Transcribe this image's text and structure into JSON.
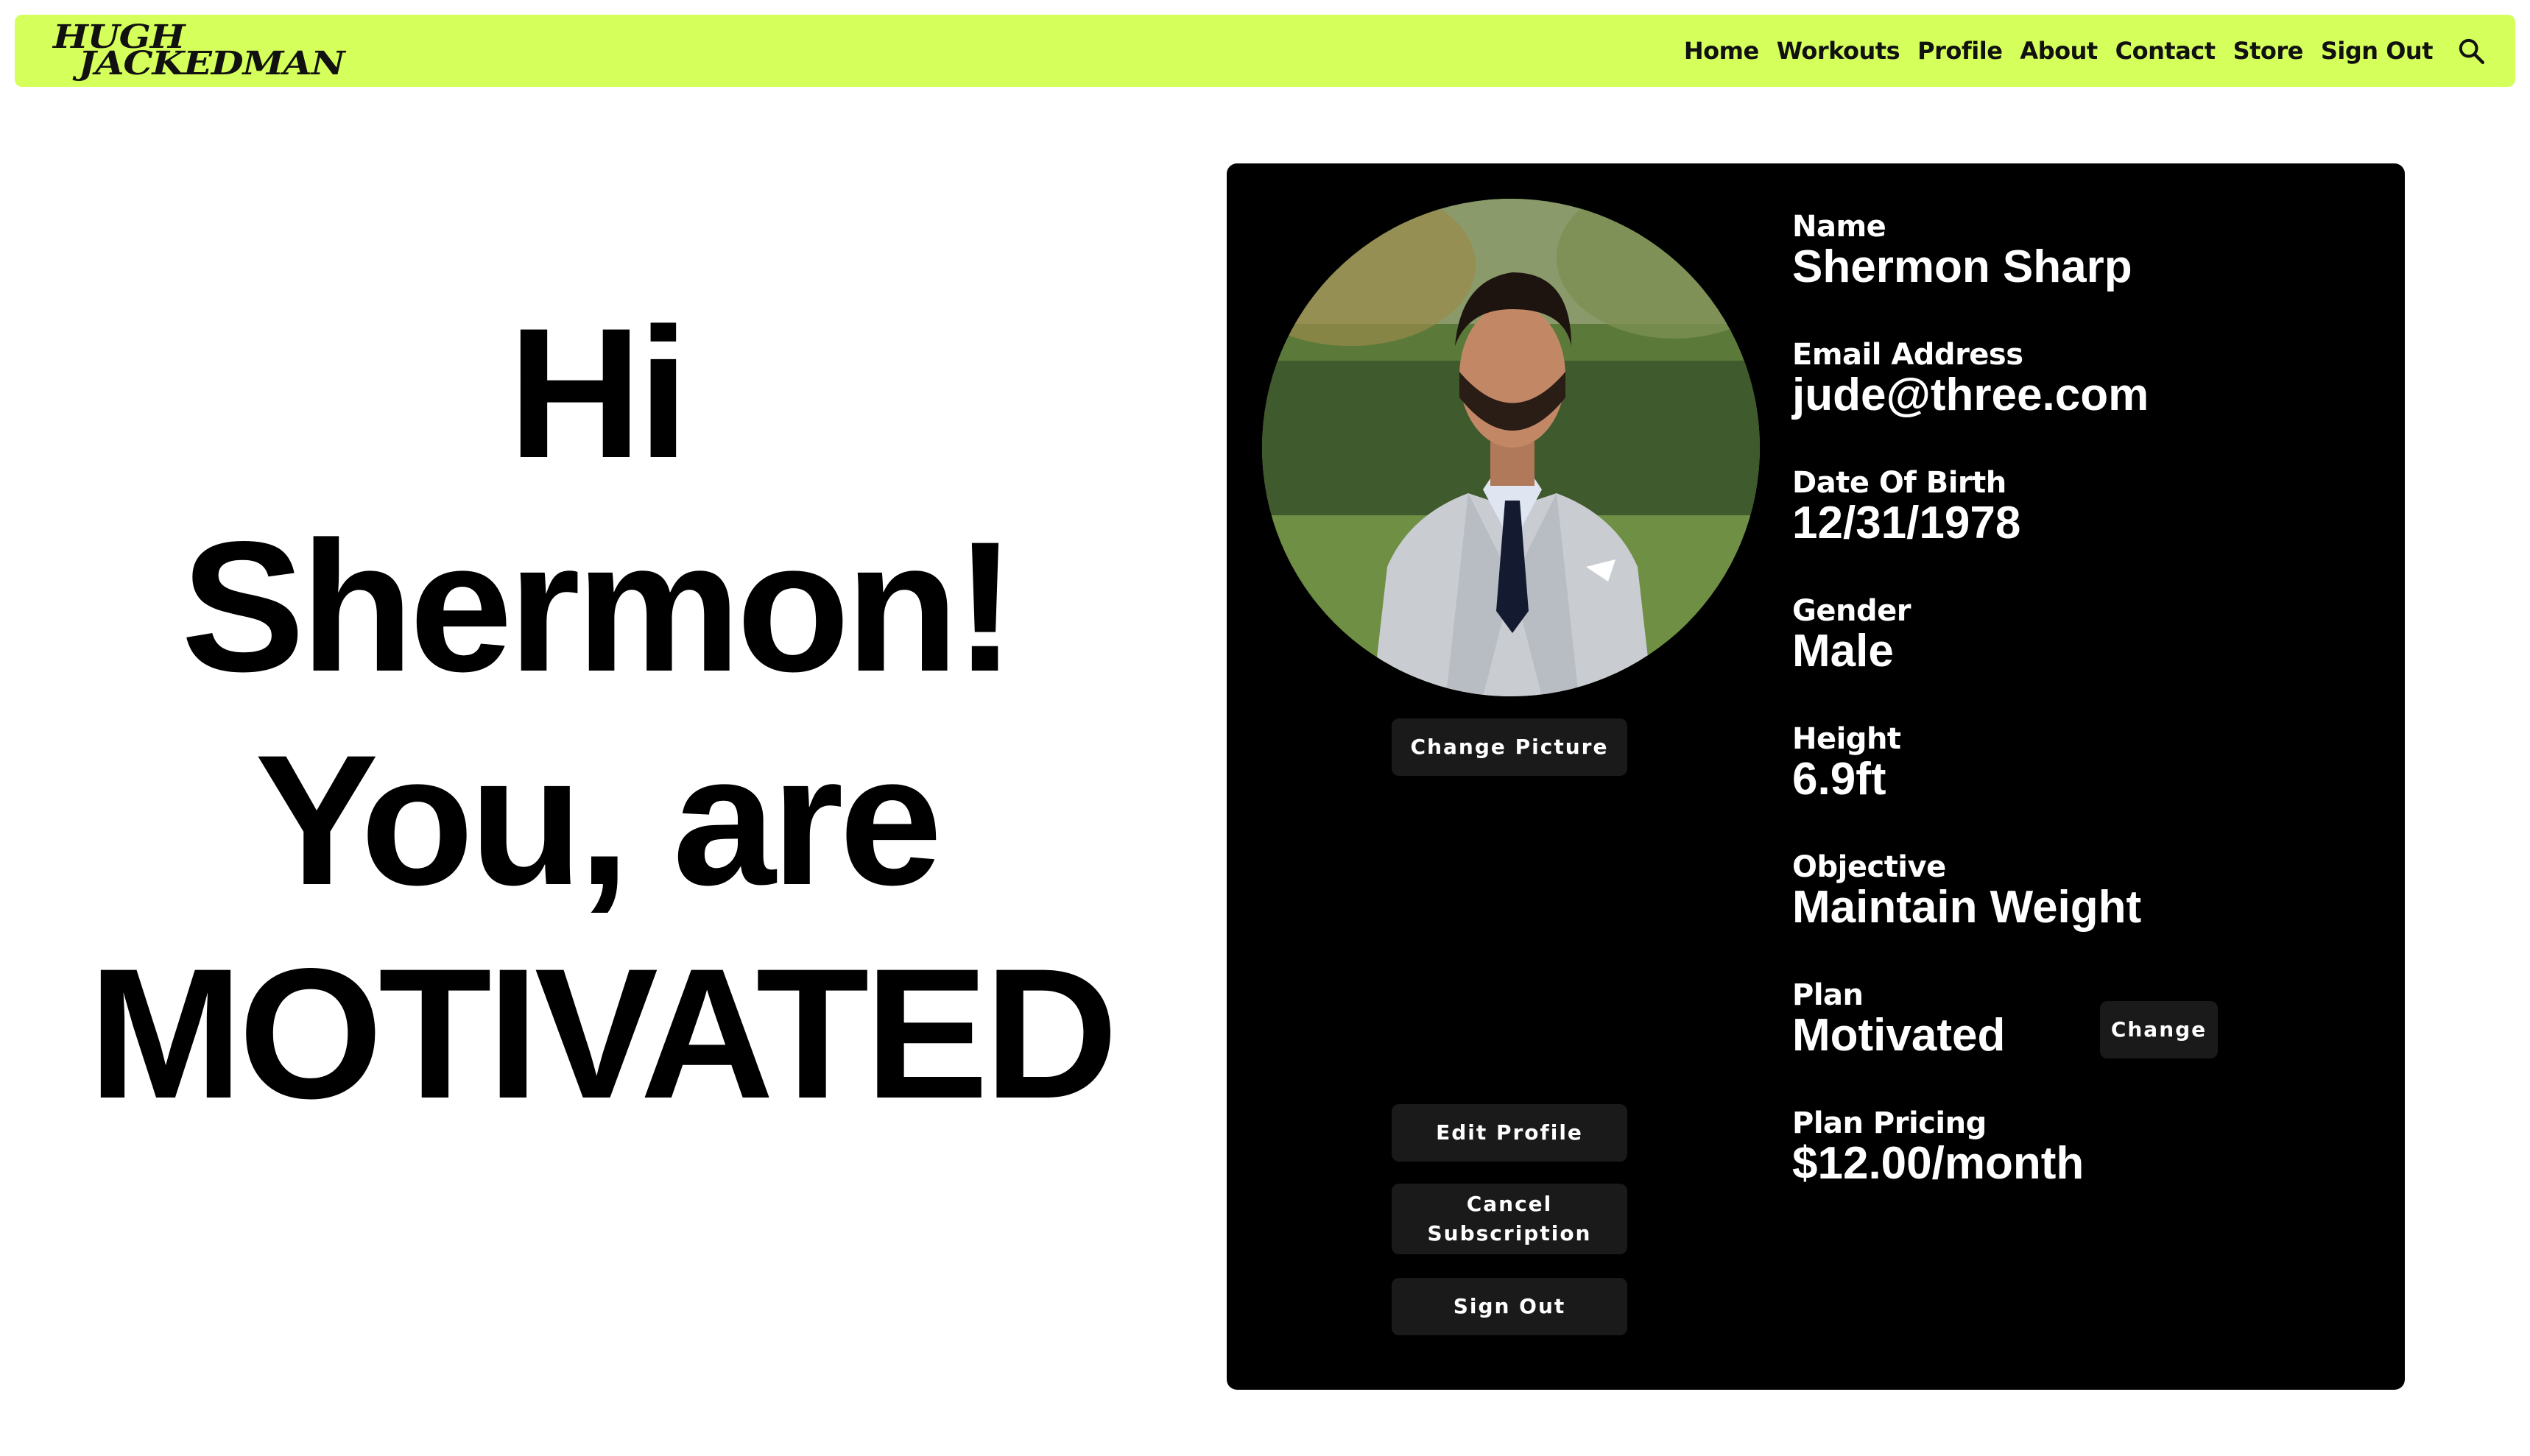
{
  "nav": {
    "logo_line1": "HUGH",
    "logo_line2": "JACKEDMAN",
    "links": [
      "Home",
      "Workouts",
      "Profile",
      "About",
      "Contact",
      "Store",
      "Sign Out"
    ],
    "search_icon": "search-icon",
    "accent_color": "#d5ff5a"
  },
  "greeting": {
    "line1": "Hi",
    "line2": "Shermon!",
    "line3": "You, are",
    "line4": "MOTIVATED"
  },
  "profile": {
    "name_label": "Name",
    "name_value": "Shermon Sharp",
    "email_label": "Email Address",
    "email_value": "jude@three.com",
    "dob_label": "Date Of Birth",
    "dob_value": "12/31/1978",
    "gender_label": "Gender",
    "gender_value": "Male",
    "height_label": "Height",
    "height_value": "6.9ft",
    "objective_label": "Objective",
    "objective_value": "Maintain Weight",
    "plan_label": "Plan",
    "plan_value": "Motivated",
    "pricing_label": "Plan Pricing",
    "pricing_value": "$12.00/month"
  },
  "buttons": {
    "change_picture": "Change Picture",
    "change_plan": "Change",
    "edit_profile": "Edit Profile",
    "cancel_subscription": "Cancel\nSubscription",
    "sign_out": "Sign Out"
  }
}
